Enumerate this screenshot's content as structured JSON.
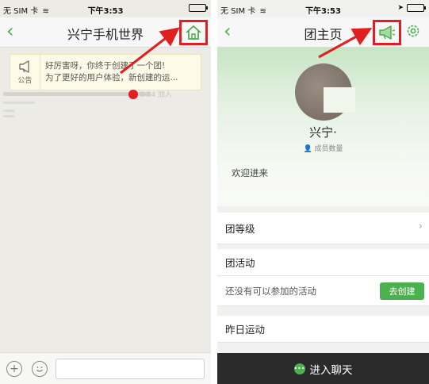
{
  "status_bar": {
    "carrier": "无 SIM 卡",
    "time": "下午3:53",
    "battery_level": 0.9
  },
  "left_screen": {
    "title": "兴宁手机世界",
    "notice": {
      "tag_label": "公告",
      "line1": "好厉害呀，你终于创建了一个团!",
      "line2": "为了更好的用户体验，新创建的运..."
    },
    "joined_text": "0·84 加入"
  },
  "right_screen": {
    "title": "团主页",
    "group_name": "兴宁·",
    "member_label": "成员数量",
    "welcome": "欢迎进来",
    "rows": {
      "level": "团等级",
      "activity": "团活动",
      "no_activity": "还没有可以参加的活动",
      "create_button": "去创建",
      "yesterday": "昨日运动"
    },
    "enter_chat": "进入聊天"
  },
  "colors": {
    "accent_green": "#4caf50",
    "highlight_red": "#e02020",
    "bottom_bar": "#2b2b2b"
  },
  "icons": {
    "left_action": "home-icon",
    "right_action": "megaphone-icon",
    "right_settings": "gear-icon",
    "notice": "megaphone-icon"
  }
}
